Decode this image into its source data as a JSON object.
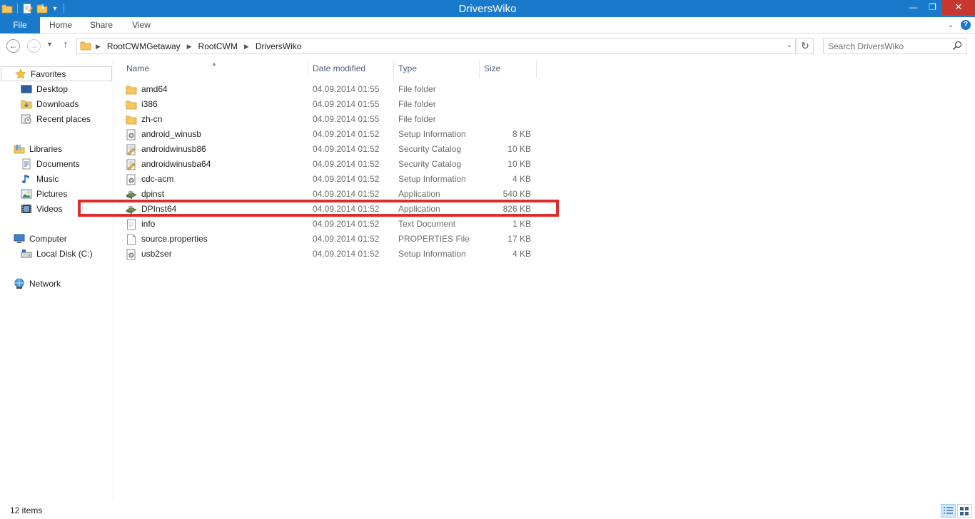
{
  "window": {
    "title": "DriversWiko",
    "controls": {
      "minimize": "—",
      "maximize": "❐",
      "close": "✕"
    }
  },
  "ribbon": {
    "tabs": [
      {
        "label": "File",
        "active": true
      },
      {
        "label": "Home"
      },
      {
        "label": "Share"
      },
      {
        "label": "View"
      }
    ],
    "help": "?"
  },
  "address": {
    "breadcrumb": [
      "RootCWMGetaway",
      "RootCWM",
      "DriversWiko"
    ]
  },
  "search": {
    "placeholder": "Search DriversWiko"
  },
  "nav_pane": {
    "favorites": {
      "label": "Favorites",
      "items": [
        {
          "label": "Desktop",
          "icon": "desktop-icon"
        },
        {
          "label": "Downloads",
          "icon": "downloads-icon"
        },
        {
          "label": "Recent places",
          "icon": "recent-places-icon"
        }
      ]
    },
    "libraries": {
      "label": "Libraries",
      "items": [
        {
          "label": "Documents",
          "icon": "documents-icon"
        },
        {
          "label": "Music",
          "icon": "music-icon"
        },
        {
          "label": "Pictures",
          "icon": "pictures-icon"
        },
        {
          "label": "Videos",
          "icon": "videos-icon"
        }
      ]
    },
    "computer": {
      "label": "Computer",
      "items": [
        {
          "label": "Local Disk (C:)",
          "icon": "local-disk-icon"
        }
      ]
    },
    "network": {
      "label": "Network"
    }
  },
  "file_list": {
    "columns": [
      "Name",
      "Date modified",
      "Type",
      "Size"
    ],
    "rows": [
      {
        "name": "amd64",
        "date": "04.09.2014 01:55",
        "type": "File folder",
        "size": "",
        "icon": "folder-icon"
      },
      {
        "name": "i386",
        "date": "04.09.2014 01:55",
        "type": "File folder",
        "size": "",
        "icon": "folder-icon"
      },
      {
        "name": "zh-cn",
        "date": "04.09.2014 01:55",
        "type": "File folder",
        "size": "",
        "icon": "folder-icon"
      },
      {
        "name": "android_winusb",
        "date": "04.09.2014 01:52",
        "type": "Setup Information",
        "size": "8 KB",
        "icon": "setup-information-icon"
      },
      {
        "name": "androidwinusb86",
        "date": "04.09.2014 01:52",
        "type": "Security Catalog",
        "size": "10 KB",
        "icon": "security-catalog-icon"
      },
      {
        "name": "androidwinusba64",
        "date": "04.09.2014 01:52",
        "type": "Security Catalog",
        "size": "10 KB",
        "icon": "security-catalog-icon"
      },
      {
        "name": "cdc-acm",
        "date": "04.09.2014 01:52",
        "type": "Setup Information",
        "size": "4 KB",
        "icon": "setup-information-icon"
      },
      {
        "name": "dpinst",
        "date": "04.09.2014 01:52",
        "type": "Application",
        "size": "540 KB",
        "icon": "application-icon"
      },
      {
        "name": "DPInst64",
        "date": "04.09.2014 01:52",
        "type": "Application",
        "size": "826 KB",
        "icon": "application-icon",
        "highlighted": true
      },
      {
        "name": "info",
        "date": "04.09.2014 01:52",
        "type": "Text Document",
        "size": "1 KB",
        "icon": "text-document-icon"
      },
      {
        "name": "source.properties",
        "date": "04.09.2014 01:52",
        "type": "PROPERTIES File",
        "size": "17 KB",
        "icon": "properties-file-icon"
      },
      {
        "name": "usb2ser",
        "date": "04.09.2014 01:52",
        "type": "Setup Information",
        "size": "4 KB",
        "icon": "setup-information-icon"
      }
    ]
  },
  "status": {
    "item_count": "12 items"
  },
  "colors": {
    "titlebar": "#1979ca",
    "close_button": "#c7372f",
    "highlight_box": "#e02b2b",
    "folder": "#f6c65a"
  }
}
